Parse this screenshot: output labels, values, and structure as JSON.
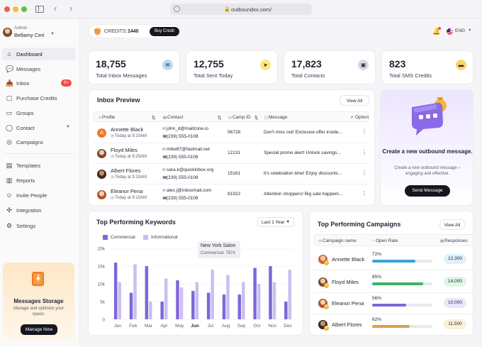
{
  "browser": {
    "url": "outboundxx.com/"
  },
  "sidebar": {
    "user": {
      "role": "Admin",
      "name": "Bellamy Ceri"
    },
    "items": [
      {
        "label": "Dashboard",
        "icon": "home-icon",
        "glyph": "⌂"
      },
      {
        "label": "Messages",
        "icon": "chat-icon",
        "glyph": "💬"
      },
      {
        "label": "Inbox",
        "icon": "inbox-icon",
        "glyph": "📥",
        "badge": "9+"
      },
      {
        "label": "Purchase Credits",
        "icon": "purchase-icon",
        "glyph": "▢"
      },
      {
        "label": "Groups",
        "icon": "groups-icon",
        "glyph": "▭"
      },
      {
        "label": "Contact",
        "icon": "contact-icon",
        "glyph": "◯"
      },
      {
        "label": "Campaigns",
        "icon": "campaign-icon",
        "glyph": "◎"
      },
      {
        "label": "Templates",
        "icon": "templates-icon",
        "glyph": "▤"
      },
      {
        "label": "Reports",
        "icon": "reports-icon",
        "glyph": "▥"
      },
      {
        "label": "Invite People",
        "icon": "invite-icon",
        "glyph": "☺"
      },
      {
        "label": "Integration",
        "icon": "integration-icon",
        "glyph": "✣"
      },
      {
        "label": "Settings",
        "icon": "settings-icon",
        "glyph": "⚙"
      }
    ],
    "storage": {
      "title": "Messages Storage",
      "desc": "Manage and optimize your space.",
      "button": "Manage Now"
    }
  },
  "topbar": {
    "credits_label": "CREDITS:",
    "credits_value": "1440",
    "buy_button": "Buy Credit",
    "language": "ENG"
  },
  "stats": [
    {
      "value": "18,755",
      "label": "Total Inbox Messages",
      "icon": "envelope-icon",
      "glyph": "✉",
      "color": "#b9dbef"
    },
    {
      "value": "12,755",
      "label": "Total Sent Today",
      "icon": "send-icon",
      "glyph": "➤",
      "color": "#fbe77d"
    },
    {
      "value": "17,823",
      "label": "Total Contacts",
      "icon": "contact-card-icon",
      "glyph": "▣",
      "color": "#d8d8e8"
    },
    {
      "value": "823",
      "label": "Total SMS Credits",
      "icon": "sms-icon",
      "glyph": "▬",
      "color": "#fbd56b"
    }
  ],
  "inbox": {
    "title": "Inbox Preview",
    "view_all": "View All",
    "columns": [
      "Profile",
      "Contact",
      "Camp ID",
      "Message",
      "Option"
    ],
    "rows": [
      {
        "name": "Annette Black",
        "time": "Today at 9:10AM",
        "email": "john_d@mailzone.io",
        "phone": "(239) 555-0108",
        "camp_id": "56728",
        "message": "Don't miss out! Exclusive offer inside..."
      },
      {
        "name": "Floyd Miles",
        "time": "Today at 9:25AM",
        "email": "mike87@fastmail.net",
        "phone": "(239) 555-0108",
        "camp_id": "12131",
        "message": "Special promo alert! Unlock savings..."
      },
      {
        "name": "Albert Flores",
        "time": "Today at 9:10AM",
        "email": "sara.k@quickinbox.org",
        "phone": "(239) 555-0108",
        "camp_id": "15161",
        "message": "It's celebration time! Enjoy discounts..."
      },
      {
        "name": "Eleanor Pena",
        "time": "Today at 9:10AM",
        "email": "alex.j@inboxmail.com",
        "phone": "(239) 555-0108",
        "camp_id": "81922",
        "message": "Attention shoppers! Big sale happeni..."
      }
    ]
  },
  "promo": {
    "title": "Create a new outbound message.",
    "desc": "Create a new outbound message – engaging and effective.",
    "button": "Send Message"
  },
  "keywords": {
    "title": "Top  Performing Keywords",
    "period": "Last 1 Year",
    "legend": [
      "Commercial",
      "Informational"
    ],
    "tooltip_title": "New York Salon",
    "tooltip_value": "Commercial: 7874"
  },
  "chart_data": {
    "type": "bar",
    "categories": [
      "Jan",
      "Feb",
      "Mar",
      "Apr",
      "May",
      "Jun",
      "Jul",
      "Aug",
      "Sep",
      "Oct",
      "Nov",
      "Dec"
    ],
    "series": [
      {
        "name": "Commercial",
        "values": [
          16000,
          7500,
          15000,
          5000,
          11000,
          8000,
          7500,
          7000,
          7000,
          14500,
          15000,
          5000
        ]
      },
      {
        "name": "Informational",
        "values": [
          10500,
          15500,
          5000,
          11500,
          9000,
          10500,
          14000,
          12500,
          10500,
          10000,
          10500,
          14000
        ]
      }
    ],
    "yticks": [
      "0",
      "5k",
      "10k",
      "15k",
      "20k"
    ],
    "ylim": [
      0,
      20000
    ],
    "colors": [
      "#7f67d8",
      "#c9bfef"
    ],
    "highlight_category": "Jun"
  },
  "campaigns": {
    "title": "Top Performing Campaigns",
    "view_all": "View All",
    "columns": [
      "Campaign name",
      "Open Rate",
      "Responses"
    ],
    "rows": [
      {
        "rank": "1",
        "name": "Annette Black",
        "rate": "72%",
        "rate_value": 0.72,
        "bar_color": "#3aa3d8",
        "responses": "12,300",
        "resp_color": "#dff1fb"
      },
      {
        "rank": "3",
        "name": "Floyd Miles",
        "rate": "85%",
        "rate_value": 0.85,
        "bar_color": "#3bb26a",
        "responses": "14,000",
        "resp_color": "#def6e3"
      },
      {
        "rank": "5",
        "name": "Eleanor Pena",
        "rate": "56%",
        "rate_value": 0.56,
        "bar_color": "#7f67d8",
        "responses": "10,000",
        "resp_color": "#ebe6fb"
      },
      {
        "rank": "4",
        "name": "Albert Flores",
        "rate": "62%",
        "rate_value": 0.62,
        "bar_color": "#d9a24a",
        "responses": "11,500",
        "resp_color": "#fdf0d9"
      }
    ]
  }
}
